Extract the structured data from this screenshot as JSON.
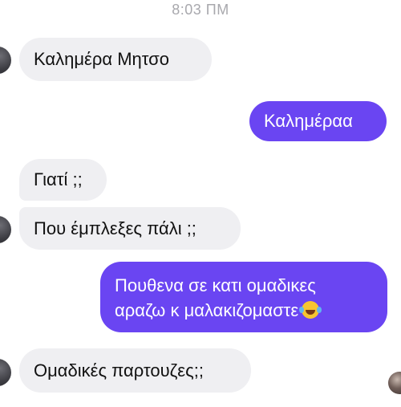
{
  "chat": {
    "timestamp": "8:03 ΠΜ",
    "messages": [
      {
        "id": "m1",
        "side": "incoming",
        "text": "Καλημέρα Μητσο"
      },
      {
        "id": "m2",
        "side": "outgoing",
        "text": "Καλημέραα"
      },
      {
        "id": "m3",
        "side": "incoming",
        "text": "Γιατί ;;"
      },
      {
        "id": "m4",
        "side": "incoming",
        "text": "Που έμπλεξες πάλι ;;"
      },
      {
        "id": "m5",
        "side": "outgoing",
        "line1": "Πουθενα σε κατι ομαδικες",
        "line2": "αραζω κ μαλακιζομαστε",
        "emoji": "face-with-tears-of-joy-emoji"
      },
      {
        "id": "m6",
        "side": "incoming",
        "text": "Ομαδικές παρτουζες;;"
      }
    ]
  },
  "colors": {
    "outgoing_bubble": "#6a45f2",
    "incoming_bubble": "#efeff2",
    "timestamp_text": "#a8a8ad"
  }
}
